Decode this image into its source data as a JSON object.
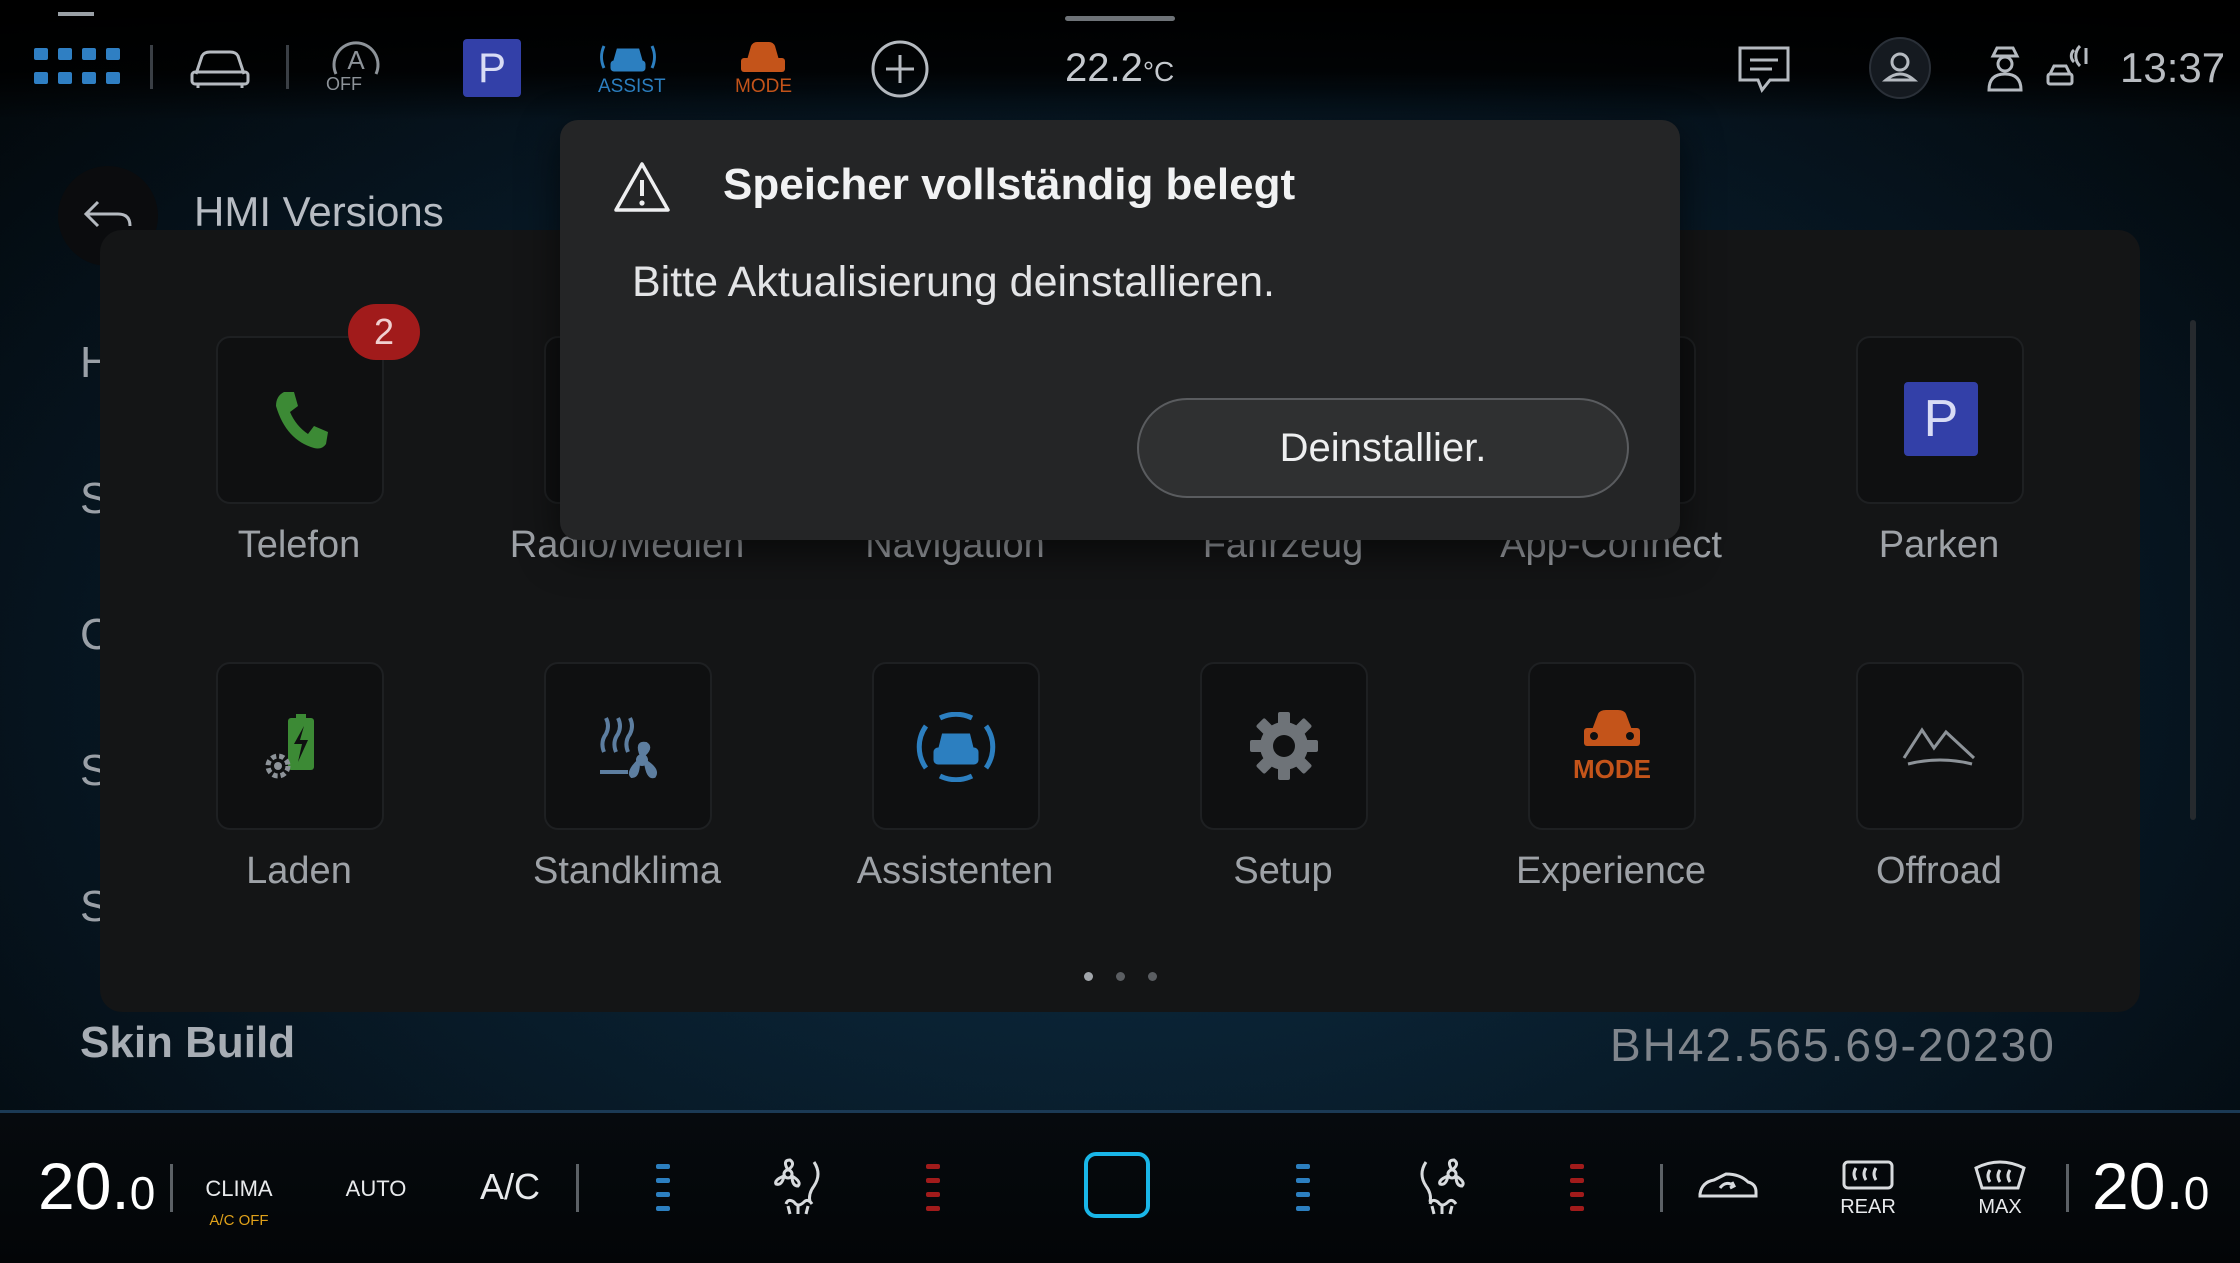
{
  "status_bar": {
    "acc_off_label": "OFF",
    "parking_label": "P",
    "assist_label": "ASSIST",
    "mode_label": "MODE",
    "temperature": "22.2",
    "temperature_unit": "°C",
    "time": "13:37",
    "icons": [
      "grid-apps-icon",
      "car-icon",
      "acc-icon",
      "parking-icon",
      "assist-icon",
      "mode-icon",
      "add-icon",
      "message-icon",
      "profile-icon",
      "driver-icon",
      "connectivity-icon"
    ]
  },
  "background_page": {
    "title": "HMI Versions",
    "row_initials": [
      "H",
      "S",
      "C",
      "S",
      "S"
    ],
    "skin_build_label": "Skin Build",
    "skin_build_value": "BH42.565.69-20230"
  },
  "launcher": {
    "apps": [
      {
        "label": "Telefon",
        "icon": "phone-icon",
        "badge": "2"
      },
      {
        "label": "Radio/Medien",
        "icon": "radio-icon"
      },
      {
        "label": "Navigation",
        "icon": "navigation-icon"
      },
      {
        "label": "Fahrzeug",
        "icon": "vehicle-icon"
      },
      {
        "label": "App-Connect",
        "icon": "app-connect-icon"
      },
      {
        "label": "Parken",
        "icon": "parking-icon",
        "icon_text": "P"
      },
      {
        "label": "Laden",
        "icon": "charging-icon"
      },
      {
        "label": "Standklima",
        "icon": "climate-icon"
      },
      {
        "label": "Assistenten",
        "icon": "assist-icon"
      },
      {
        "label": "Setup",
        "icon": "gear-icon"
      },
      {
        "label": "Experience",
        "icon": "mode-icon",
        "icon_text": "MODE"
      },
      {
        "label": "Offroad",
        "icon": "mountain-icon"
      }
    ],
    "page_count": 3,
    "current_page": 1
  },
  "dialog": {
    "title": "Speicher vollständig belegt",
    "message": "Bitte Aktualisierung deinstallieren.",
    "button_label": "Deinstallier."
  },
  "climate_bar": {
    "left_temp_main": "20.",
    "left_temp_decimal": "0",
    "right_temp_main": "20.",
    "right_temp_decimal": "0",
    "clima_label": "CLIMA",
    "ac_off_label": "A/C OFF",
    "auto_label": "AUTO",
    "ac_label": "A/C",
    "rear_label": "REAR",
    "max_label": "MAX"
  },
  "colors": {
    "accent_blue": "#2c7fc0",
    "badge_red": "#a11b1b",
    "mode_orange": "#c4541a",
    "ac_off_orange": "#e0a11a",
    "home_button": "#19b6e8"
  }
}
